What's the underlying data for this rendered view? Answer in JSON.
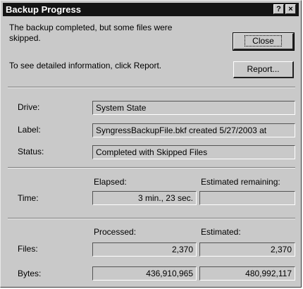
{
  "window": {
    "title": "Backup Progress",
    "help_label": "?",
    "close_label": "×"
  },
  "message": {
    "line1": "The backup completed, but some files were",
    "line2": "skipped.",
    "report_hint": "To see detailed information, click Report."
  },
  "buttons": {
    "close": "Close",
    "report": "Report..."
  },
  "info": {
    "drive_label": "Drive:",
    "drive_value": "System State",
    "label_label": "Label:",
    "label_value": "SyngressBackupFile.bkf created 5/27/2003 at",
    "status_label": "Status:",
    "status_value": "Completed with Skipped Files"
  },
  "time": {
    "elapsed_header": "Elapsed:",
    "remaining_header": "Estimated remaining:",
    "label": "Time:",
    "elapsed_value": "3 min., 23 sec.",
    "remaining_value": ""
  },
  "counts": {
    "processed_header": "Processed:",
    "estimated_header": "Estimated:",
    "files_label": "Files:",
    "files_processed": "2,370",
    "files_estimated": "2,370",
    "bytes_label": "Bytes:",
    "bytes_processed": "436,910,965",
    "bytes_estimated": "480,992,117"
  }
}
